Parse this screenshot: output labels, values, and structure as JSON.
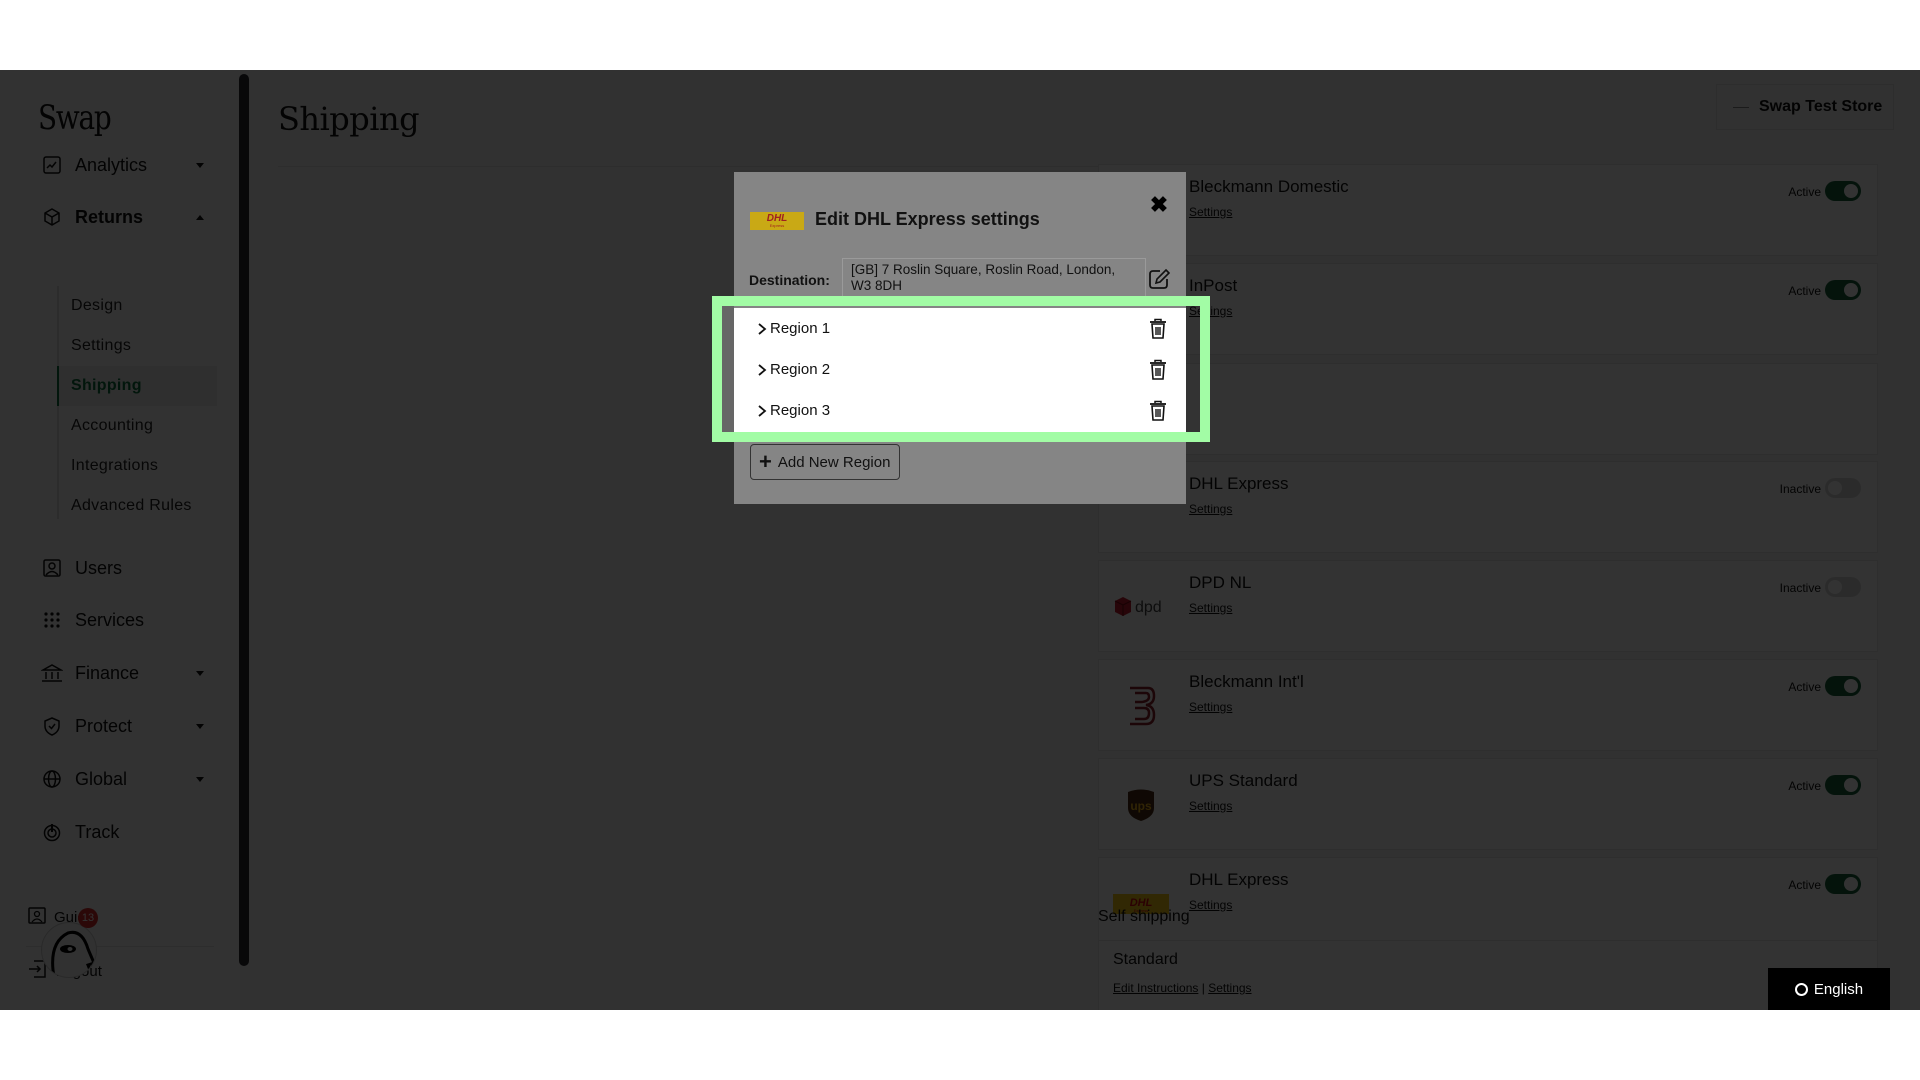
{
  "app": {
    "logo": "Swap",
    "page_title": "Shipping",
    "store_name": "Swap Test Store"
  },
  "sidebar": {
    "items": [
      {
        "label": "Analytics",
        "icon": "chart-icon",
        "caret": "down"
      },
      {
        "label": "Returns",
        "icon": "box-icon",
        "caret": "up"
      },
      {
        "label": "Users",
        "icon": "user-icon"
      },
      {
        "label": "Services",
        "icon": "grid-icon"
      },
      {
        "label": "Finance",
        "icon": "bank-icon",
        "caret": "down"
      },
      {
        "label": "Protect",
        "icon": "shield-icon",
        "caret": "down"
      },
      {
        "label": "Global",
        "icon": "globe-icon",
        "caret": "down"
      },
      {
        "label": "Track",
        "icon": "track-icon"
      }
    ],
    "returns_sub": [
      "Design",
      "Settings",
      "Shipping",
      "Accounting",
      "Integrations",
      "Advanced Rules"
    ],
    "active_sub": "Shipping",
    "bottom": {
      "guide_label": "Guide",
      "logout_label": "Logout"
    },
    "notification_count": "13"
  },
  "carriers": [
    {
      "name": "Bleckmann Domestic",
      "settings": "Settings",
      "status": "Active",
      "on": true,
      "logo": "none"
    },
    {
      "name": "InPost",
      "settings": "Settings",
      "status": "Active",
      "on": true,
      "logo": "none"
    },
    {
      "name": "",
      "settings": "",
      "status": "",
      "on": null,
      "logo": "none"
    },
    {
      "name": "DHL Express",
      "settings": "Settings",
      "status": "Inactive",
      "on": false,
      "logo": "none"
    },
    {
      "name": "DPD NL",
      "settings": "Settings",
      "status": "Inactive",
      "on": false,
      "logo": "dpd"
    },
    {
      "name": "Bleckmann Int'l",
      "settings": "Settings",
      "status": "Active",
      "on": true,
      "logo": "bleckmann"
    },
    {
      "name": "UPS Standard",
      "settings": "Settings",
      "status": "Active",
      "on": true,
      "logo": "ups"
    },
    {
      "name": "DHL Express",
      "settings": "Settings",
      "status": "Active",
      "on": true,
      "logo": "dhl"
    }
  ],
  "self_shipping": {
    "title": "Self shipping",
    "name": "Standard",
    "edit_instructions": "Edit Instructions",
    "separator": "|",
    "settings": "Settings"
  },
  "language": {
    "label": "English"
  },
  "modal": {
    "logo_text": "DHL",
    "logo_sub": "Express",
    "title": "Edit DHL Express settings",
    "destination_label": "Destination:",
    "destination_value": "[GB] 7 Roslin Square, Roslin Road, London, W3 8DH",
    "regions": [
      "Region 1",
      "Region 2",
      "Region 3"
    ],
    "add_region_label": "Add New Region"
  },
  "colors": {
    "accent": "#155e3a",
    "highlight": "#a2fca5",
    "badge": "#d42a2a",
    "dhl_yellow": "#c9a915"
  }
}
